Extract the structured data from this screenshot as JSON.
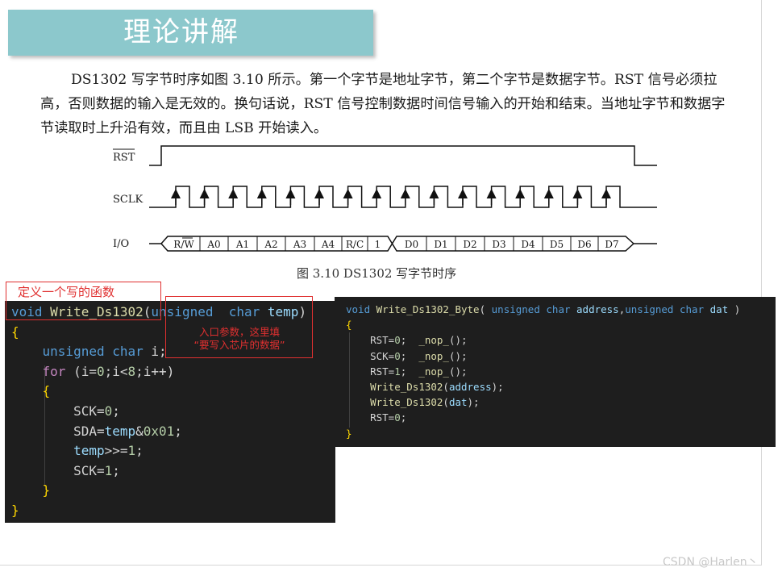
{
  "slide": {
    "title": "理论讲解",
    "paragraph": "DS1302 写字节时序如图 3.10 所示。第一个字节是地址字节，第二个字节是数据字节。RST 信号必须拉高，否则数据的输入是无效的。换句话说，RST 信号控制数据时间信号输入的开始和结束。当地址字节和数据字节读取时上升沿有效，而且由 LSB 开始读入。"
  },
  "timing_diagram": {
    "signals": [
      "RST",
      "SCLK",
      "I/O"
    ],
    "io_bits_address": [
      "R/W",
      "A0",
      "A1",
      "A2",
      "A3",
      "A4",
      "R/C",
      "1"
    ],
    "io_bits_data": [
      "D0",
      "D1",
      "D2",
      "D3",
      "D4",
      "D5",
      "D6",
      "D7"
    ],
    "caption": "图 3.10    DS1302 写字节时序"
  },
  "annotations": {
    "func_note": "定义一个写的函数",
    "param_note_line1": "入口参数，这里填",
    "param_note_line2": "“要写入芯片的数据”"
  },
  "code_left": {
    "lines": [
      "void Write_Ds1302(unsigned  char temp)",
      "{",
      "    unsigned char i;",
      "    for (i=0;i<8;i++)",
      "    {",
      "        SCK=0;",
      "        SDA=temp&0x01;",
      "        temp>>=1;",
      "        SCK=1;",
      "    }",
      "}"
    ]
  },
  "code_right": {
    "lines": [
      "void Write_Ds1302_Byte( unsigned char address,unsigned char dat )",
      "{",
      "    RST=0;  _nop_();",
      "    SCK=0;  _nop_();",
      "    RST=1;  _nop_();",
      "    Write_Ds1302(address);",
      "    Write_Ds1302(dat);",
      "    RST=0;",
      "}"
    ]
  },
  "watermark": "CSDN @Harlen丶"
}
